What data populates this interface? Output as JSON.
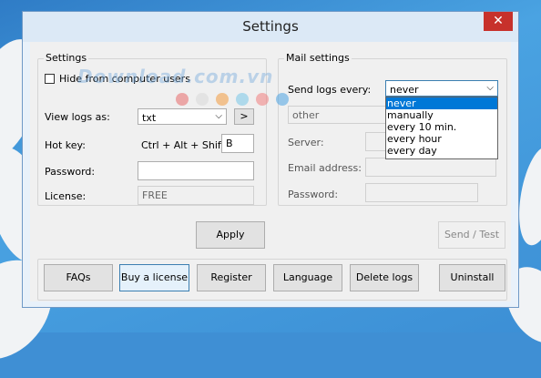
{
  "window": {
    "title": "Settings",
    "close_glyph": "✕"
  },
  "watermark": "Download.com.vn",
  "settings_group": {
    "label": "Settings",
    "hide_label": "Hide from computer users",
    "view_logs_label": "View logs as:",
    "view_logs_value": "txt",
    "view_logs_button": ">",
    "hotkey_label": "Hot key:",
    "hotkey_prefix": "Ctrl + Alt + Shift +",
    "hotkey_value": "B",
    "password_label": "Password:",
    "password_value": "",
    "license_label": "License:",
    "license_value": "FREE"
  },
  "mail_group": {
    "label": "Mail settings",
    "send_every_label": "Send logs every:",
    "send_every_value": "never",
    "send_every_options": [
      "never",
      "manually",
      "every 10 min.",
      "every hour",
      "every day"
    ],
    "other_placeholder": "other",
    "server_label": "Server:",
    "email_label": "Email address:",
    "password_label": "Password:"
  },
  "apply_button": "Apply",
  "send_test_button": "Send / Test",
  "bottom_buttons": {
    "faqs": "FAQs",
    "buy": "Buy a license",
    "register": "Register",
    "language": "Language",
    "delete_logs": "Delete logs",
    "uninstall": "Uninstall"
  },
  "colors": {
    "close_button": "#c7312b",
    "dropdown_highlight": "#0078d7",
    "focus_border": "#3c7fb1"
  },
  "icons": {
    "close": "close-icon",
    "dropdown_arrow": "chevron-down-icon"
  }
}
